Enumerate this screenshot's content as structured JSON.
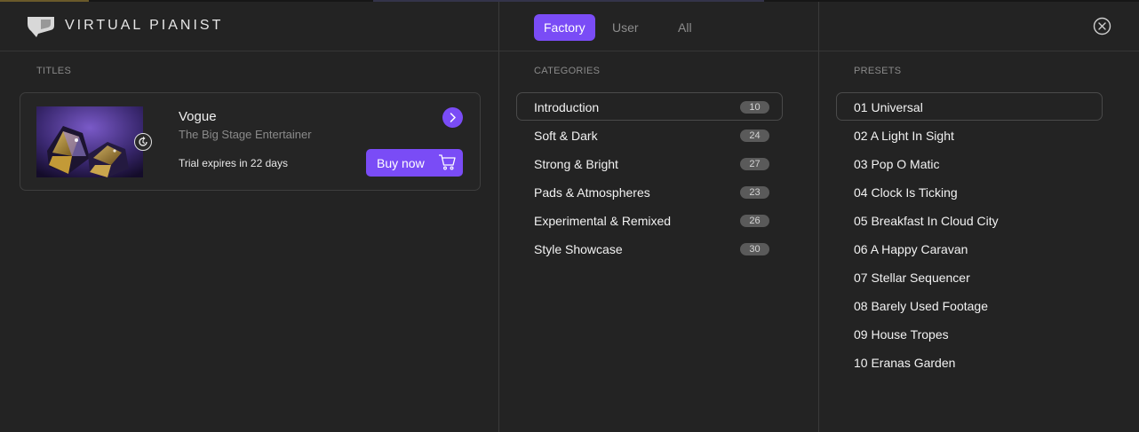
{
  "header": {
    "brand": "VIRTUAL PIANIST",
    "tabs": [
      {
        "label": "Factory",
        "active": true
      },
      {
        "label": "User",
        "active": false
      },
      {
        "label": "All",
        "active": false
      }
    ]
  },
  "titles": {
    "section_label": "TITLES",
    "card": {
      "title": "Vogue",
      "subtitle": "The Big Stage Entertainer",
      "trial": "Trial expires in 22 days",
      "buy_label": "Buy now"
    }
  },
  "categories": {
    "section_label": "CATEGORIES",
    "items": [
      {
        "label": "Introduction",
        "count": "10"
      },
      {
        "label": "Soft & Dark",
        "count": "24"
      },
      {
        "label": "Strong & Bright",
        "count": "27"
      },
      {
        "label": "Pads & Atmospheres",
        "count": "23"
      },
      {
        "label": "Experimental & Remixed",
        "count": "26"
      },
      {
        "label": "Style Showcase",
        "count": "30"
      }
    ]
  },
  "presets": {
    "section_label": "PRESETS",
    "items": [
      {
        "label": "01 Universal"
      },
      {
        "label": "02 A Light In Sight"
      },
      {
        "label": "03 Pop O Matic"
      },
      {
        "label": "04 Clock Is Ticking"
      },
      {
        "label": "05 Breakfast In Cloud City"
      },
      {
        "label": "06 A Happy Caravan"
      },
      {
        "label": "07 Stellar Sequencer"
      },
      {
        "label": "08 Barely Used Footage"
      },
      {
        "label": "09 House Tropes"
      },
      {
        "label": "10 Eranas Garden"
      }
    ]
  },
  "colors": {
    "background": "#232323",
    "accent": "#7a4cf6",
    "divider": "#3a3a3a",
    "muted_text": "#8a8a8a",
    "count_badge": "#5a5a5a"
  },
  "icons": {
    "logo": "speech-bubble-logo-icon",
    "close": "close-circle-icon",
    "arrow": "chevron-right-icon",
    "cart": "cart-icon",
    "badge": "refresh-badge-icon"
  }
}
